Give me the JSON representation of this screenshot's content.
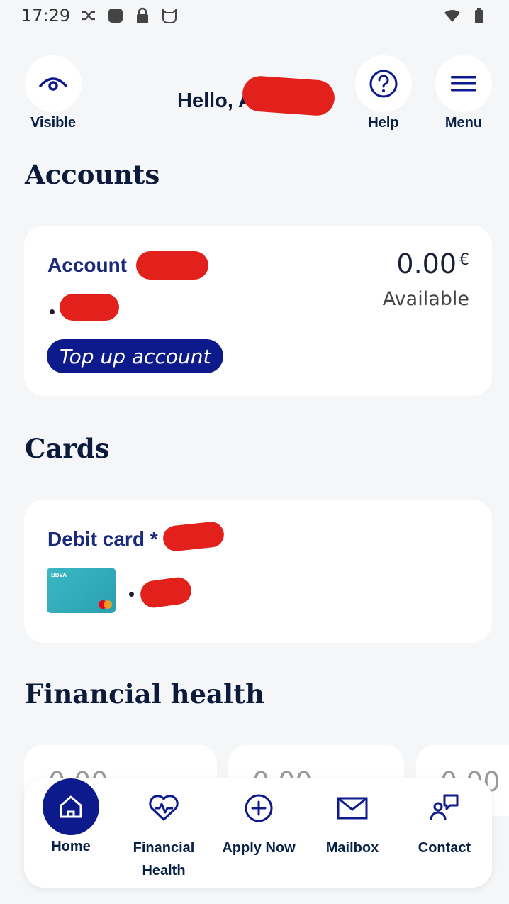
{
  "status_bar": {
    "time": "17:29",
    "icons": [
      "shuffle-icon",
      "square-app-icon",
      "lock-icon",
      "cat-icon",
      "wifi-icon",
      "battery-icon"
    ]
  },
  "header": {
    "visible_label": "Visible",
    "greeting": "Hello, A",
    "help_label": "Help",
    "menu_label": "Menu"
  },
  "accounts": {
    "title": "Accounts",
    "account_name": "Account",
    "balance": "0.00",
    "currency": "€",
    "balance_caption": "Available",
    "topup_label": "Top up account"
  },
  "cards": {
    "title": "Cards",
    "card_name": "Debit card *",
    "card_brand": "BBVA"
  },
  "financial_health": {
    "title": "Financial health",
    "mini_values": [
      "0.00",
      "0.00",
      "0.00"
    ]
  },
  "bottom_nav": {
    "items": [
      {
        "label": "Home",
        "icon": "home-icon",
        "active": true
      },
      {
        "label": "Financial Health",
        "icon": "heart-pulse-icon"
      },
      {
        "label": "Apply Now",
        "icon": "plus-circle-icon"
      },
      {
        "label": "Mailbox",
        "icon": "mail-icon"
      },
      {
        "label": "Contact",
        "icon": "contact-icon"
      }
    ]
  },
  "colors": {
    "accent": "#0c1a8c",
    "background": "#f4f6f8",
    "redaction": "#e3211c"
  }
}
